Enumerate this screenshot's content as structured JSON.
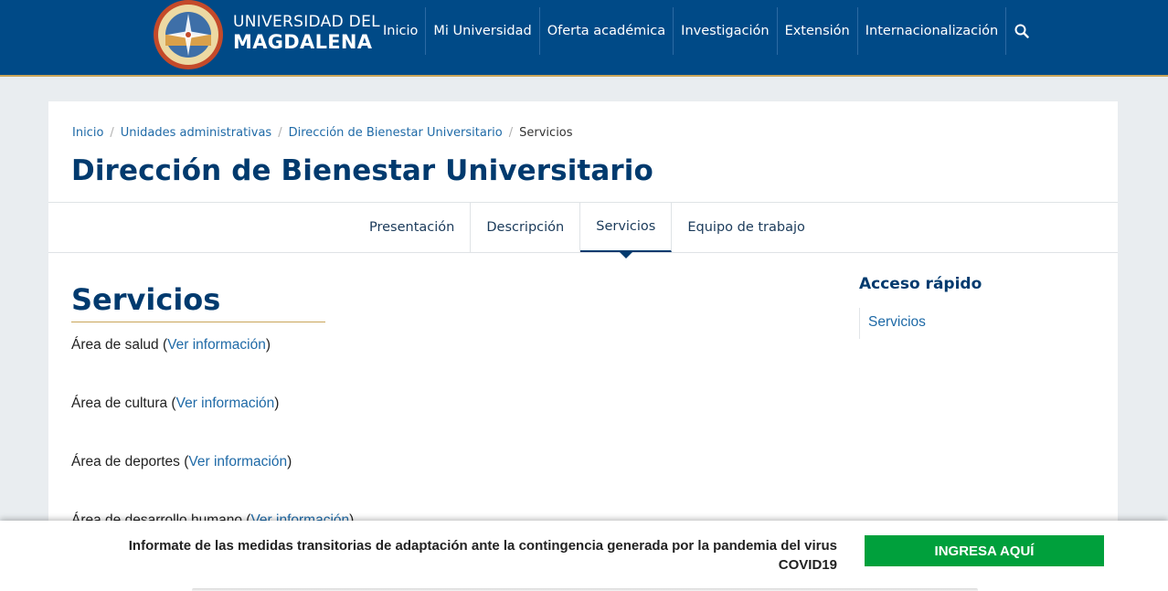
{
  "header": {
    "brand_line1": "UNIVERSIDAD DEL",
    "brand_line2": "MAGDALENA",
    "nav": [
      "Inicio",
      "Mi Universidad",
      "Oferta académica",
      "Investigación",
      "Extensión",
      "Internacionalización"
    ],
    "search_icon": "search-icon",
    "colors": {
      "bar": "#004a87",
      "accent": "#c9a55a"
    }
  },
  "breadcrumb": {
    "items": [
      "Inicio",
      "Unidades administrativas",
      "Dirección de Bienestar Universitario"
    ],
    "separator": "/",
    "current": "Servicios"
  },
  "page_title": "Dirección de Bienestar Universitario",
  "tabs": {
    "items": [
      "Presentación",
      "Descripción",
      "Servicios",
      "Equipo de trabajo"
    ],
    "active": "Servicios"
  },
  "main": {
    "title": "Servicios",
    "services": [
      {
        "prefix": "Área de salud (",
        "link": "Ver información",
        "suffix": ")"
      },
      {
        "prefix": "Área de cultura (",
        "link": "Ver información",
        "suffix": ")"
      },
      {
        "prefix": "Área de deportes (",
        "link": "Ver información",
        "suffix": ")"
      },
      {
        "prefix": "Área de desarrollo humano (",
        "link": "Ver información",
        "suffix": ")"
      }
    ]
  },
  "sidebar": {
    "title": "Acceso rápido",
    "items": [
      "Servicios"
    ]
  },
  "notice": {
    "text_line1": "Informate de las medidas transitorias de adaptación ante la contingencia generada por la pandemia del virus",
    "text_line2": "COVID19",
    "button": "INGRESA AQUÍ",
    "button_color": "#00a03c"
  }
}
